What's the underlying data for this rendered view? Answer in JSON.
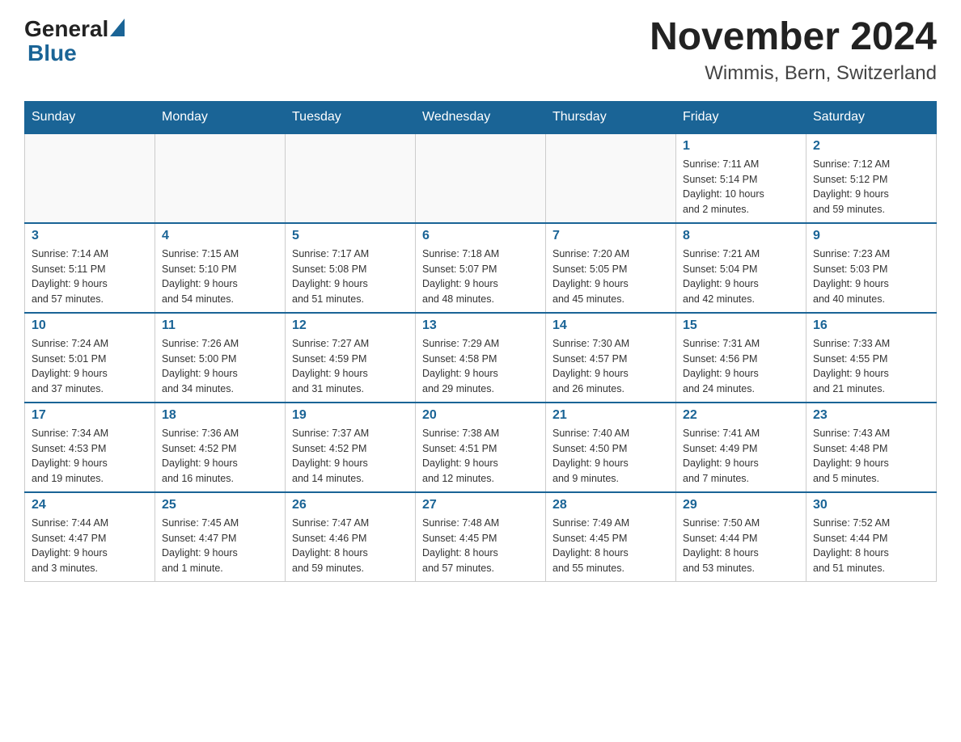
{
  "header": {
    "logo_text1": "General",
    "logo_text2": "Blue",
    "title": "November 2024",
    "subtitle": "Wimmis, Bern, Switzerland"
  },
  "weekdays": [
    "Sunday",
    "Monday",
    "Tuesday",
    "Wednesday",
    "Thursday",
    "Friday",
    "Saturday"
  ],
  "weeks": [
    {
      "days": [
        {
          "number": "",
          "info": ""
        },
        {
          "number": "",
          "info": ""
        },
        {
          "number": "",
          "info": ""
        },
        {
          "number": "",
          "info": ""
        },
        {
          "number": "",
          "info": ""
        },
        {
          "number": "1",
          "info": "Sunrise: 7:11 AM\nSunset: 5:14 PM\nDaylight: 10 hours\nand 2 minutes."
        },
        {
          "number": "2",
          "info": "Sunrise: 7:12 AM\nSunset: 5:12 PM\nDaylight: 9 hours\nand 59 minutes."
        }
      ]
    },
    {
      "days": [
        {
          "number": "3",
          "info": "Sunrise: 7:14 AM\nSunset: 5:11 PM\nDaylight: 9 hours\nand 57 minutes."
        },
        {
          "number": "4",
          "info": "Sunrise: 7:15 AM\nSunset: 5:10 PM\nDaylight: 9 hours\nand 54 minutes."
        },
        {
          "number": "5",
          "info": "Sunrise: 7:17 AM\nSunset: 5:08 PM\nDaylight: 9 hours\nand 51 minutes."
        },
        {
          "number": "6",
          "info": "Sunrise: 7:18 AM\nSunset: 5:07 PM\nDaylight: 9 hours\nand 48 minutes."
        },
        {
          "number": "7",
          "info": "Sunrise: 7:20 AM\nSunset: 5:05 PM\nDaylight: 9 hours\nand 45 minutes."
        },
        {
          "number": "8",
          "info": "Sunrise: 7:21 AM\nSunset: 5:04 PM\nDaylight: 9 hours\nand 42 minutes."
        },
        {
          "number": "9",
          "info": "Sunrise: 7:23 AM\nSunset: 5:03 PM\nDaylight: 9 hours\nand 40 minutes."
        }
      ]
    },
    {
      "days": [
        {
          "number": "10",
          "info": "Sunrise: 7:24 AM\nSunset: 5:01 PM\nDaylight: 9 hours\nand 37 minutes."
        },
        {
          "number": "11",
          "info": "Sunrise: 7:26 AM\nSunset: 5:00 PM\nDaylight: 9 hours\nand 34 minutes."
        },
        {
          "number": "12",
          "info": "Sunrise: 7:27 AM\nSunset: 4:59 PM\nDaylight: 9 hours\nand 31 minutes."
        },
        {
          "number": "13",
          "info": "Sunrise: 7:29 AM\nSunset: 4:58 PM\nDaylight: 9 hours\nand 29 minutes."
        },
        {
          "number": "14",
          "info": "Sunrise: 7:30 AM\nSunset: 4:57 PM\nDaylight: 9 hours\nand 26 minutes."
        },
        {
          "number": "15",
          "info": "Sunrise: 7:31 AM\nSunset: 4:56 PM\nDaylight: 9 hours\nand 24 minutes."
        },
        {
          "number": "16",
          "info": "Sunrise: 7:33 AM\nSunset: 4:55 PM\nDaylight: 9 hours\nand 21 minutes."
        }
      ]
    },
    {
      "days": [
        {
          "number": "17",
          "info": "Sunrise: 7:34 AM\nSunset: 4:53 PM\nDaylight: 9 hours\nand 19 minutes."
        },
        {
          "number": "18",
          "info": "Sunrise: 7:36 AM\nSunset: 4:52 PM\nDaylight: 9 hours\nand 16 minutes."
        },
        {
          "number": "19",
          "info": "Sunrise: 7:37 AM\nSunset: 4:52 PM\nDaylight: 9 hours\nand 14 minutes."
        },
        {
          "number": "20",
          "info": "Sunrise: 7:38 AM\nSunset: 4:51 PM\nDaylight: 9 hours\nand 12 minutes."
        },
        {
          "number": "21",
          "info": "Sunrise: 7:40 AM\nSunset: 4:50 PM\nDaylight: 9 hours\nand 9 minutes."
        },
        {
          "number": "22",
          "info": "Sunrise: 7:41 AM\nSunset: 4:49 PM\nDaylight: 9 hours\nand 7 minutes."
        },
        {
          "number": "23",
          "info": "Sunrise: 7:43 AM\nSunset: 4:48 PM\nDaylight: 9 hours\nand 5 minutes."
        }
      ]
    },
    {
      "days": [
        {
          "number": "24",
          "info": "Sunrise: 7:44 AM\nSunset: 4:47 PM\nDaylight: 9 hours\nand 3 minutes."
        },
        {
          "number": "25",
          "info": "Sunrise: 7:45 AM\nSunset: 4:47 PM\nDaylight: 9 hours\nand 1 minute."
        },
        {
          "number": "26",
          "info": "Sunrise: 7:47 AM\nSunset: 4:46 PM\nDaylight: 8 hours\nand 59 minutes."
        },
        {
          "number": "27",
          "info": "Sunrise: 7:48 AM\nSunset: 4:45 PM\nDaylight: 8 hours\nand 57 minutes."
        },
        {
          "number": "28",
          "info": "Sunrise: 7:49 AM\nSunset: 4:45 PM\nDaylight: 8 hours\nand 55 minutes."
        },
        {
          "number": "29",
          "info": "Sunrise: 7:50 AM\nSunset: 4:44 PM\nDaylight: 8 hours\nand 53 minutes."
        },
        {
          "number": "30",
          "info": "Sunrise: 7:52 AM\nSunset: 4:44 PM\nDaylight: 8 hours\nand 51 minutes."
        }
      ]
    }
  ]
}
